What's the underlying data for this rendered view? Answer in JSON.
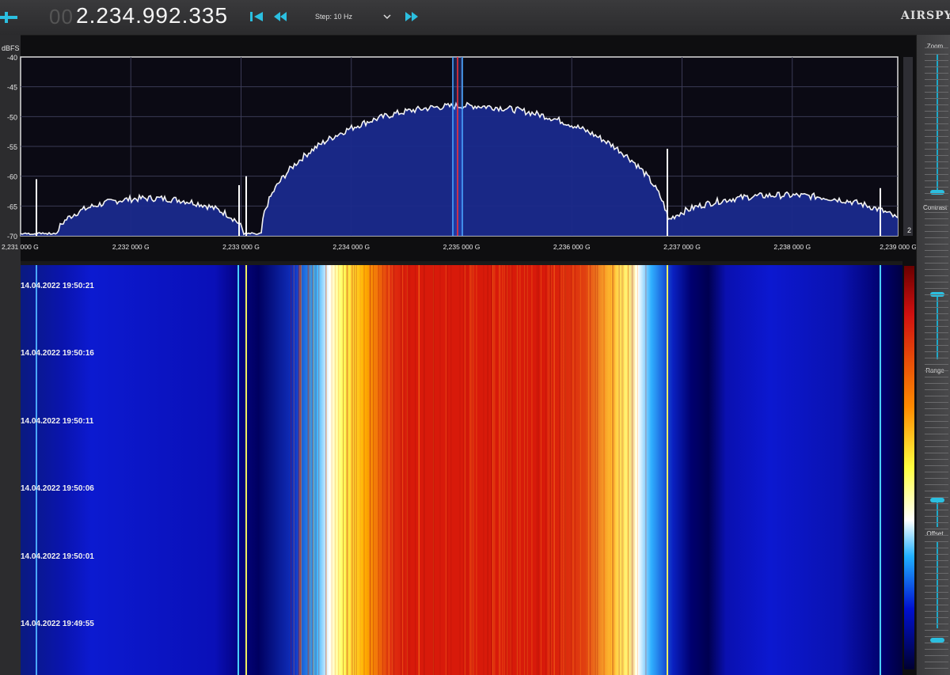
{
  "toolbar": {
    "power_icon": "power-toggle-icon",
    "frequency_prefix": "00",
    "frequency": "2.234.992.335",
    "step_label": "Step: 10 Hz",
    "logo": "AIRSPY"
  },
  "spectrum": {
    "unit_label": "dBFS",
    "y_ticks": [
      "-40",
      "-45",
      "-50",
      "-55",
      "-60",
      "-65",
      "-70"
    ],
    "x_ticks": [
      "2,231 000 G",
      "2,232 000 G",
      "2,233 000 G",
      "2,234 000 G",
      "2,235 000 G",
      "2,236 000 G",
      "2,237 000 G",
      "2,238 000 G",
      "2,239 000 G"
    ],
    "corner_badge": "2"
  },
  "waterfall": {
    "timestamps": [
      "14.04.2022 19:50:21",
      "14.04.2022 19:50:16",
      "14.04.2022 19:50:11",
      "14.04.2022 19:50:06",
      "14.04.2022 19:50:01",
      "14.04.2022 19:49:55"
    ]
  },
  "side_panel": {
    "zoom_label": "Zoom",
    "contrast_label": "Contrast",
    "range_label": "Range",
    "offset_label": "Offset"
  },
  "colors": {
    "accent": "#2bbfe0",
    "spectrum_fill": "#1a2a8c",
    "trace": "#f2f2f2",
    "waterfall_hot": "#d81a0a",
    "waterfall_cold": "#0a0ab0"
  }
}
